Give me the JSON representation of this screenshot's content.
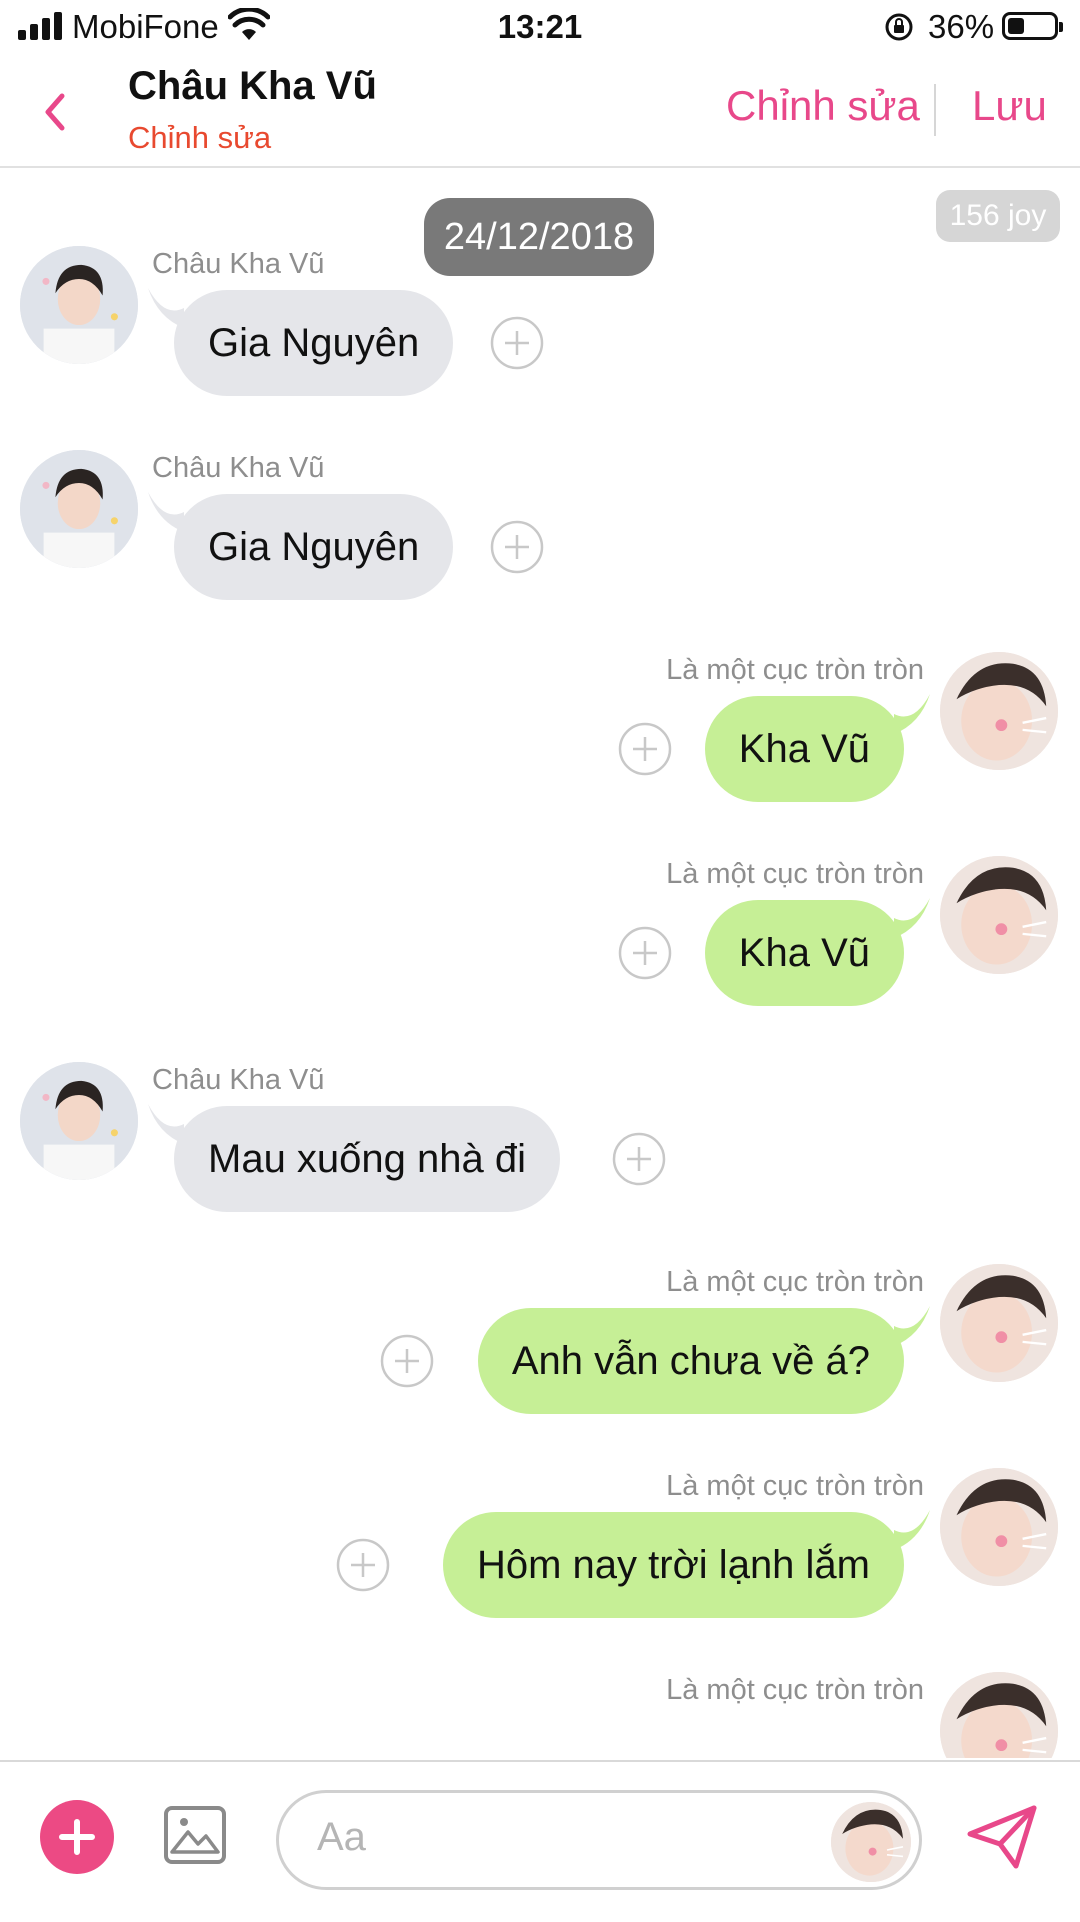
{
  "status": {
    "carrier": "MobiFone",
    "time": "13:21",
    "battery": "36%",
    "battery_level": 0.36
  },
  "nav": {
    "title": "Châu Kha Vũ",
    "subtitle": "Chỉnh sửa",
    "edit": "Chỉnh sửa",
    "save": "Lưu"
  },
  "chat": {
    "date": "24/12/2018",
    "joy": "156 joy",
    "messages": [
      {
        "side": "in",
        "sender": "Châu Kha Vũ",
        "text": "Gia Nguyên"
      },
      {
        "side": "in",
        "sender": "Châu Kha Vũ",
        "text": "Gia Nguyên"
      },
      {
        "side": "out",
        "sender": "Là một cục tròn tròn",
        "text": "Kha Vũ"
      },
      {
        "side": "out",
        "sender": "Là một cục tròn tròn",
        "text": "Kha Vũ"
      },
      {
        "side": "in",
        "sender": "Châu Kha Vũ",
        "text": "Mau xuống nhà đi"
      },
      {
        "side": "out",
        "sender": "Là một cục tròn tròn",
        "text": "Anh vẫn chưa về á?"
      },
      {
        "side": "out",
        "sender": "Là một cục tròn tròn",
        "text": "Hôm nay trời lạnh lắm"
      },
      {
        "side": "out",
        "sender": "Là một cục tròn tròn",
        "text": ""
      }
    ]
  },
  "composer": {
    "placeholder": "Aa"
  },
  "icons": {
    "back": "chevron-left-icon",
    "add": "plus-icon",
    "image": "image-icon",
    "send": "send-icon",
    "add_reaction": "plus-circle-icon"
  },
  "colors": {
    "accent": "#e8488a",
    "subtitle": "#e8492f",
    "bubble_in": "#e5e6ea",
    "bubble_out": "#c6ef96",
    "date_pill": "#797979"
  }
}
